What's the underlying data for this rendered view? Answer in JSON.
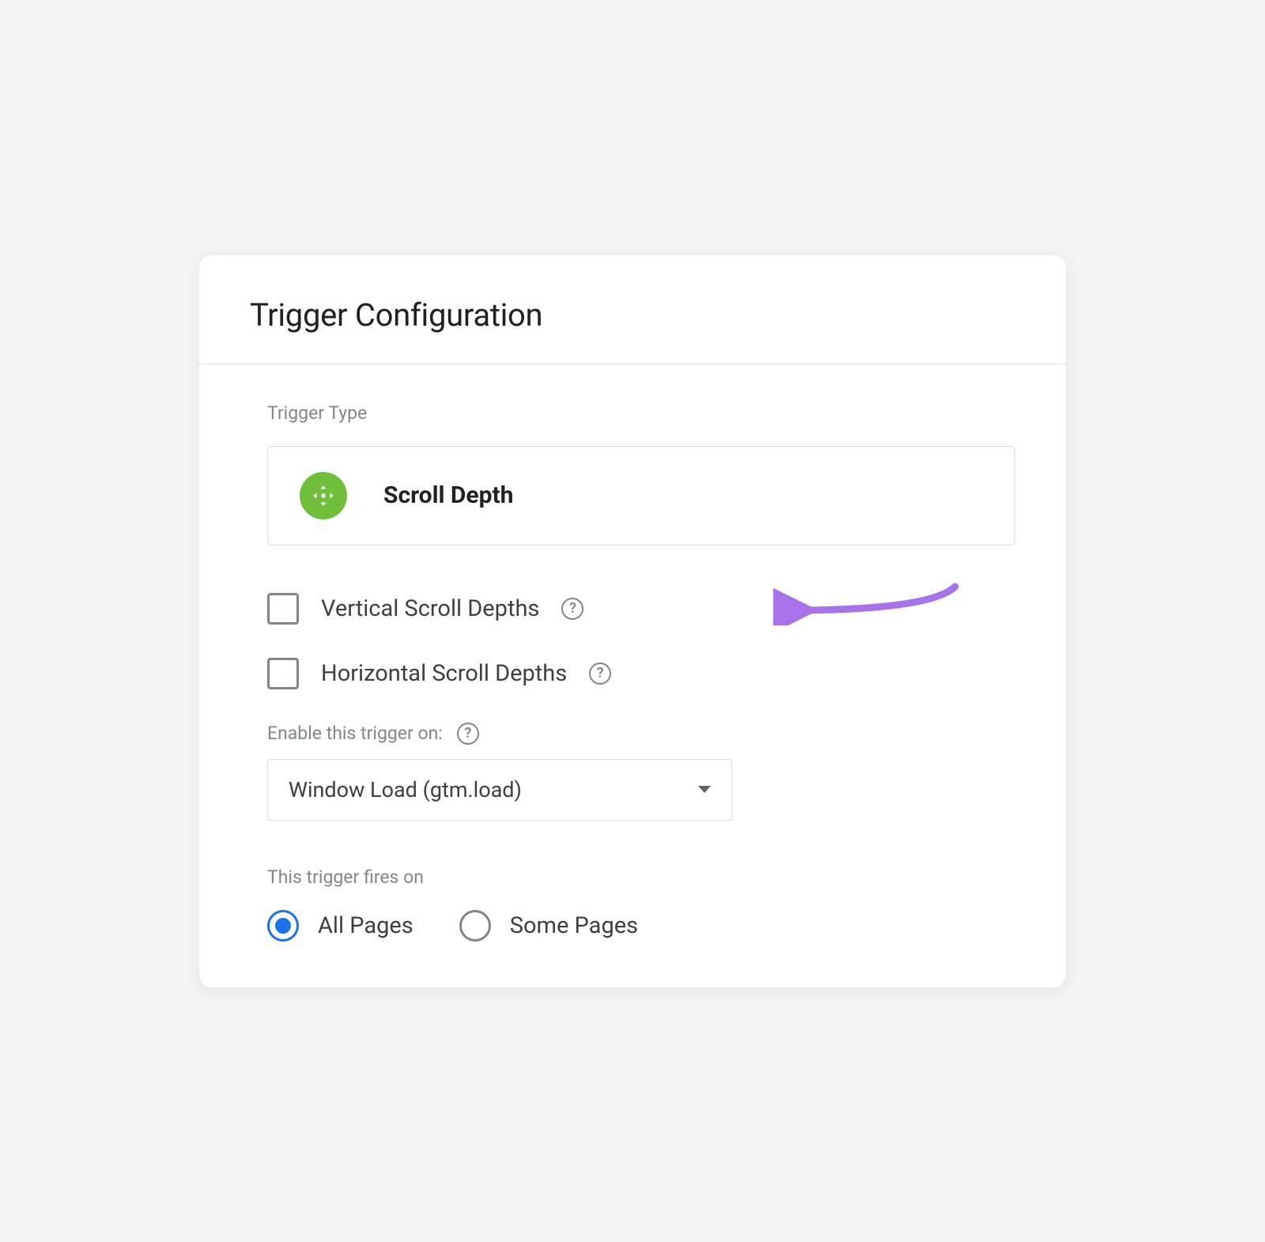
{
  "header": {
    "title": "Trigger Configuration"
  },
  "trigger_type": {
    "label": "Trigger Type",
    "selected": "Scroll Depth"
  },
  "checkboxes": {
    "vertical": {
      "label": "Vertical Scroll Depths",
      "checked": false
    },
    "horizontal": {
      "label": "Horizontal Scroll Depths",
      "checked": false
    }
  },
  "enable_on": {
    "label": "Enable this trigger on:",
    "selected": "Window Load (gtm.load)"
  },
  "fires_on": {
    "label": "This trigger fires on",
    "options": {
      "all": "All Pages",
      "some": "Some Pages"
    },
    "selected": "all"
  }
}
